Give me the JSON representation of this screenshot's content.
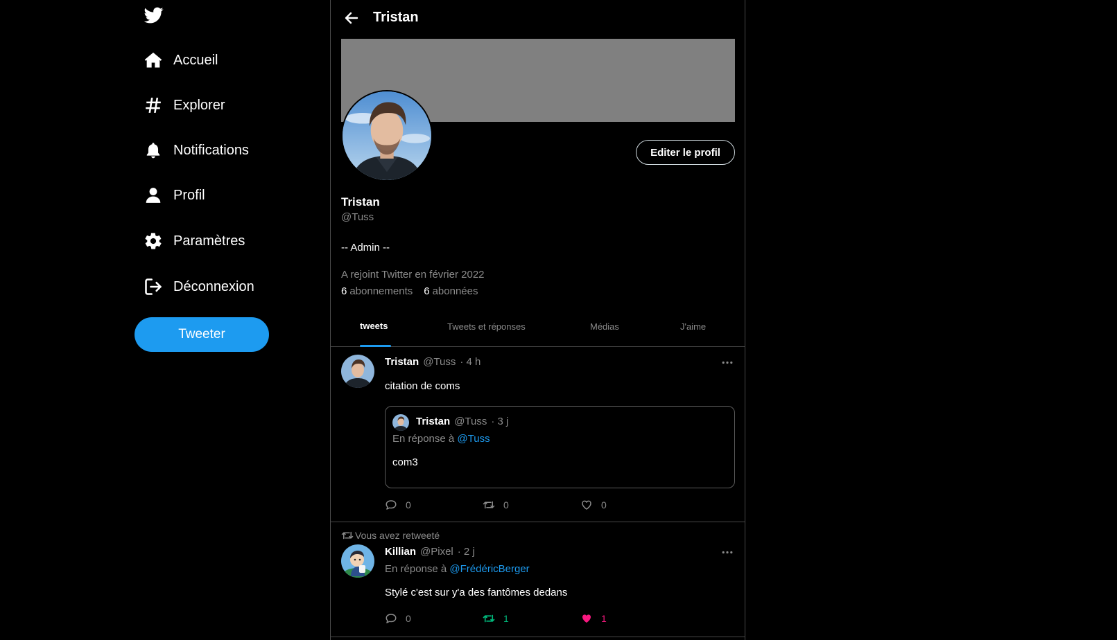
{
  "sidebar": {
    "logo": "twitter-bird-icon",
    "items": [
      {
        "label": "Accueil",
        "icon": "home-icon"
      },
      {
        "label": "Explorer",
        "icon": "hashtag-icon"
      },
      {
        "label": "Notifications",
        "icon": "bell-icon"
      },
      {
        "label": "Profil",
        "icon": "user-icon"
      },
      {
        "label": "Paramètres",
        "icon": "gear-icon"
      },
      {
        "label": "Déconnexion",
        "icon": "logout-icon"
      }
    ],
    "tweet_button": "Tweeter"
  },
  "header": {
    "title": "Tristan"
  },
  "profile": {
    "edit_button": "Editer le profil",
    "name": "Tristan",
    "handle": "@Tuss",
    "bio": "-- Admin --",
    "joined": "A rejoint Twitter en février 2022",
    "following_count": "6",
    "following_label": "abonnements",
    "followers_count": "6",
    "followers_label": "abonnées"
  },
  "tabs": [
    "tweets",
    "Tweets et réponses",
    "Médias",
    "J'aime"
  ],
  "tweets": [
    {
      "name": "Tristan",
      "handle": "@Tuss",
      "date": "· 4 h",
      "text": "citation de coms",
      "quote": {
        "name": "Tristan",
        "handle": "@Tuss",
        "date": "· 3 j",
        "reply_prefix": "En réponse à",
        "reply_to": "@Tuss",
        "text": "com3"
      },
      "replies": "0",
      "retweets": "0",
      "likes": "0"
    },
    {
      "retweeted_label": "Vous avez retweeté",
      "name": "Killian",
      "handle": "@Pixel",
      "date": "· 2 j",
      "reply_prefix": "En réponse à",
      "reply_to": "@FrédéricBerger",
      "text": "Stylé c'est sur y'a des fantômes dedans",
      "replies": "0",
      "retweets": "1",
      "likes": "1"
    }
  ],
  "colors": {
    "accent": "#1d9bf0",
    "retweet_active": "#00ba7c",
    "like_active": "#f91880",
    "banner": "#808080"
  }
}
